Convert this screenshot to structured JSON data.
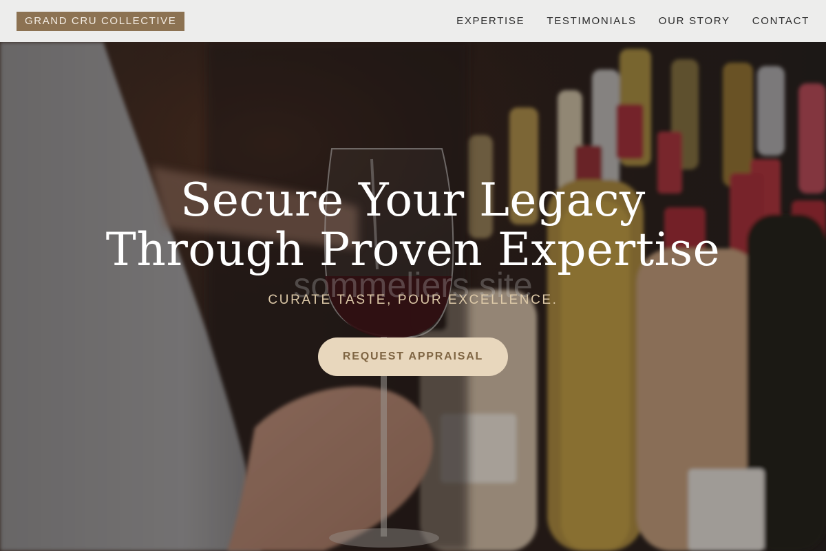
{
  "brand": {
    "name": "GRAND CRU COLLECTIVE"
  },
  "nav": {
    "links": [
      {
        "label": "EXPERTISE"
      },
      {
        "label": "TESTIMONIALS"
      },
      {
        "label": "OUR STORY"
      },
      {
        "label": "CONTACT"
      }
    ]
  },
  "hero": {
    "headline_line1": "Secure Your Legacy",
    "headline_line2": "Through Proven Expertise",
    "ghost_text": "sommeliers site",
    "tagline": "CURATE TASTE, POUR EXCELLENCE.",
    "cta_label": "REQUEST APPRAISAL"
  },
  "colors": {
    "brand_bg": "#8c7252",
    "cta_bg": "#e8d7bd",
    "cta_text": "#7f6543",
    "tagline": "#ddc9a8"
  }
}
